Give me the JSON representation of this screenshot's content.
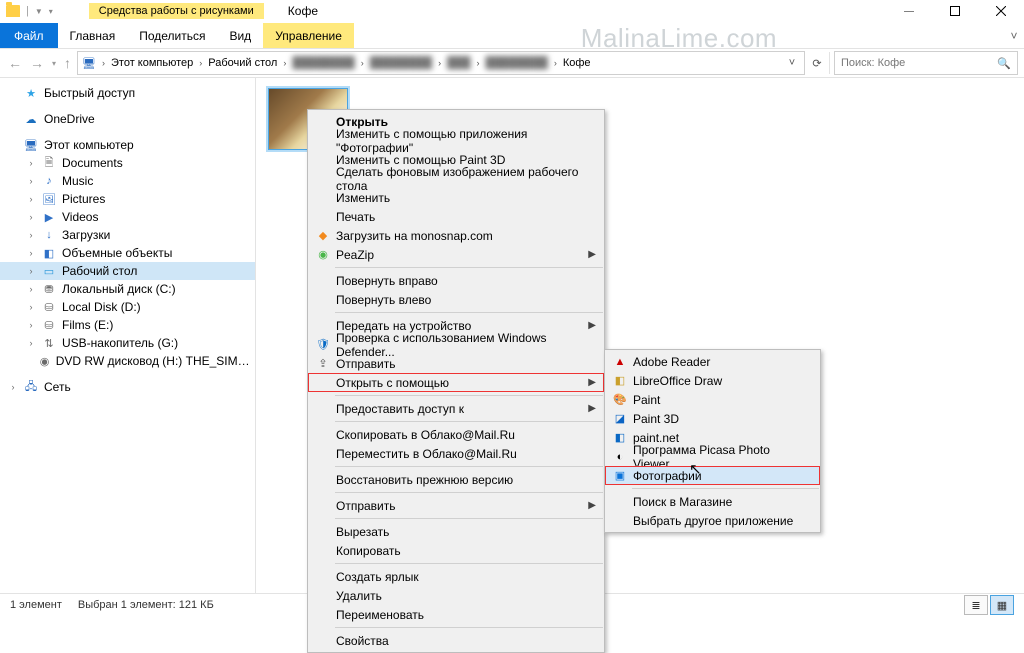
{
  "window_title": "Кофе",
  "contextual_tab_header": "Средства работы с рисунками",
  "ribbon_tabs": {
    "file": "Файл",
    "home": "Главная",
    "share": "Поделиться",
    "view": "Вид",
    "manage": "Управление"
  },
  "watermark": "MalinaLime.com",
  "address_bar": {
    "root": "Этот компьютер",
    "desktop": "Рабочий стол",
    "current": "Кофе"
  },
  "search_placeholder": "Поиск: Кофе",
  "sidebar": {
    "quick": "Быстрый доступ",
    "onedrive": "OneDrive",
    "thispc": "Этот компьютер",
    "documents": "Documents",
    "music": "Music",
    "pictures": "Pictures",
    "videos": "Videos",
    "downloads": "Загрузки",
    "objects3d": "Объемные объекты",
    "desktop_item": "Рабочий стол",
    "localc": "Локальный диск (C:)",
    "locald": "Local Disk (D:)",
    "filmse": "Films (E:)",
    "usbg": "USB-накопитель (G:)",
    "dvdh": "DVD RW дисковод (H:) THE_SIMPSONS_MOVIE",
    "network": "Сеть"
  },
  "ctx_main": {
    "open": "Открыть",
    "edit_photos": "Изменить с помощью приложения \"Фотографии\"",
    "edit_paint3d": "Изменить с помощью Paint 3D",
    "set_wallpaper": "Сделать фоновым изображением рабочего стола",
    "edit": "Изменить",
    "print": "Печать",
    "monosnap": "Загрузить на monosnap.com",
    "peazip": "PeaZip",
    "rotate_r": "Повернуть вправо",
    "rotate_l": "Повернуть влево",
    "cast": "Передать на устройство",
    "defender": "Проверка с использованием Windows Defender...",
    "share": "Отправить",
    "open_with": "Открыть с помощью",
    "give_access": "Предоставить доступ к",
    "copy_cloud": "Скопировать в Облако@Mail.Ru",
    "move_cloud": "Переместить в Облако@Mail.Ru",
    "restore": "Восстановить прежнюю версию",
    "send_to": "Отправить",
    "cut": "Вырезать",
    "copy": "Копировать",
    "shortcut": "Создать ярлык",
    "delete": "Удалить",
    "rename": "Переименовать",
    "props": "Свойства"
  },
  "ctx_sub": {
    "adobe": "Adobe Reader",
    "libre": "LibreOffice Draw",
    "paint": "Paint",
    "paint3d": "Paint 3D",
    "paintnet": "paint.net",
    "picasa": "Программа Picasa Photo Viewer",
    "photos": "Фотографии",
    "store": "Поиск в Магазине",
    "choose": "Выбрать другое приложение"
  },
  "status": {
    "count": "1 элемент",
    "selection": "Выбран 1 элемент: 121 КБ"
  }
}
